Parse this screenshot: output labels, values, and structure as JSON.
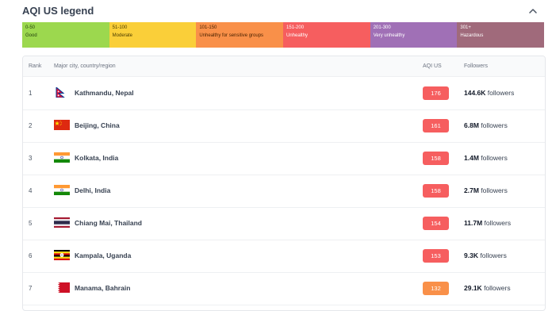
{
  "header": {
    "title": "AQI US legend"
  },
  "legend": [
    {
      "range": "0-50",
      "label": "Good",
      "color": "#9cd84e",
      "text_color": "#1f3d0b"
    },
    {
      "range": "51-100",
      "label": "Moderate",
      "color": "#facf39",
      "text_color": "#4a3b00"
    },
    {
      "range": "101-150",
      "label": "Unhealthy for sensitive groups",
      "color": "#f99049",
      "text_color": "#4a2200"
    },
    {
      "range": "151-200",
      "label": "Unhealthy",
      "color": "#f65e5f",
      "text_color": "#ffffff"
    },
    {
      "range": "201-300",
      "label": "Very unhealthy",
      "color": "#a070b6",
      "text_color": "#ffffff"
    },
    {
      "range": "301+",
      "label": "Hazardous",
      "color": "#a06a7b",
      "text_color": "#ffffff"
    }
  ],
  "table": {
    "columns": {
      "rank": "Rank",
      "city": "Major city, country/region",
      "aqi": "AQI US",
      "followers": "Followers"
    },
    "rows": [
      {
        "rank": "1",
        "city": "Kathmandu, Nepal",
        "flag": "nepal-flag-icon",
        "aqi": "176",
        "aqi_color": "#f65e5f",
        "followers_value": "144.6K",
        "followers_word": "followers"
      },
      {
        "rank": "2",
        "city": "Beijing, China",
        "flag": "china-flag-icon",
        "aqi": "161",
        "aqi_color": "#f65e5f",
        "followers_value": "6.8M",
        "followers_word": "followers"
      },
      {
        "rank": "3",
        "city": "Kolkata, India",
        "flag": "india-flag-icon",
        "aqi": "158",
        "aqi_color": "#f65e5f",
        "followers_value": "1.4M",
        "followers_word": "followers"
      },
      {
        "rank": "4",
        "city": "Delhi, India",
        "flag": "india-flag-icon",
        "aqi": "158",
        "aqi_color": "#f65e5f",
        "followers_value": "2.7M",
        "followers_word": "followers"
      },
      {
        "rank": "5",
        "city": "Chiang Mai, Thailand",
        "flag": "thailand-flag-icon",
        "aqi": "154",
        "aqi_color": "#f65e5f",
        "followers_value": "11.7M",
        "followers_word": "followers"
      },
      {
        "rank": "6",
        "city": "Kampala, Uganda",
        "flag": "uganda-flag-icon",
        "aqi": "153",
        "aqi_color": "#f65e5f",
        "followers_value": "9.3K",
        "followers_word": "followers"
      },
      {
        "rank": "7",
        "city": "Manama, Bahrain",
        "flag": "bahrain-flag-icon",
        "aqi": "132",
        "aqi_color": "#f99049",
        "followers_value": "29.1K",
        "followers_word": "followers"
      }
    ]
  }
}
